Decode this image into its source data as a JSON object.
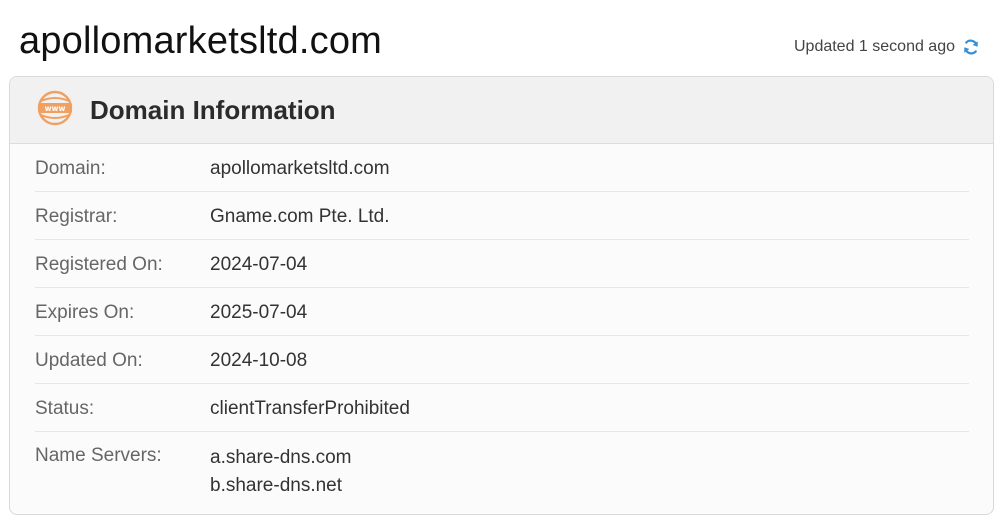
{
  "header": {
    "site_title": "apollomarketsltd.com",
    "updated_text": "Updated 1 second ago",
    "refresh_icon": "refresh-icon"
  },
  "card": {
    "title": "Domain Information",
    "icon": "www-icon",
    "accent_color": "#f0a060"
  },
  "domain_info": {
    "domain": {
      "label": "Domain:",
      "value": "apollomarketsltd.com"
    },
    "registrar": {
      "label": "Registrar:",
      "value": "Gname.com Pte. Ltd."
    },
    "registered_on": {
      "label": "Registered On:",
      "value": "2024-07-04"
    },
    "expires_on": {
      "label": "Expires On:",
      "value": "2025-07-04"
    },
    "updated_on": {
      "label": "Updated On:",
      "value": "2024-10-08"
    },
    "status": {
      "label": "Status:",
      "value": "clientTransferProhibited"
    },
    "name_servers": {
      "label": "Name Servers:",
      "values": [
        "a.share-dns.com",
        "b.share-dns.net"
      ]
    }
  }
}
